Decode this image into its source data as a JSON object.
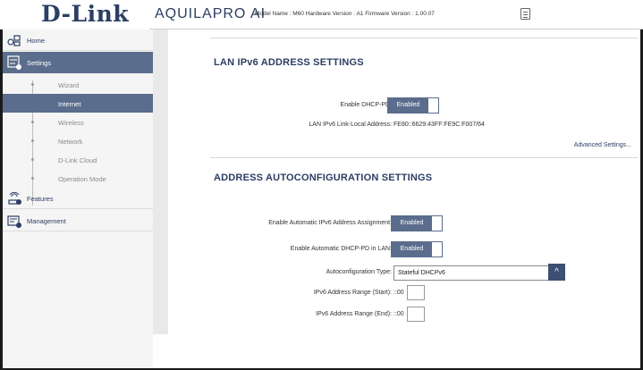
{
  "header": {
    "logo": "D-Link",
    "brand": "AQUILAPRO AI",
    "model_info": "Model Name : M60 Hardware Version : A1 Firmware Version : 1.00.07"
  },
  "sidebar": {
    "home": "Home",
    "settings": "Settings",
    "settings_items": [
      "Wizard",
      "Internet",
      "Wireless",
      "Network",
      "D-Link Cloud",
      "Operation Mode"
    ],
    "features": "Features",
    "management": "Management"
  },
  "lan_section": {
    "title": "LAN IPv6 ADDRESS SETTINGS",
    "dhcp_pd_label": "Enable DHCP-PD:",
    "dhcp_pd_value": "Enabled",
    "link_local_label": "LAN IPv6 Link-Local Address:",
    "link_local_value": "FE80::6629:43FF:FE9C:F007/64",
    "advanced": "Advanced Settings..."
  },
  "auto_section": {
    "title": "ADDRESS AUTOCONFIGURATION SETTINGS",
    "auto_assign_label": "Enable Automatic IPv6 Address Assignment:",
    "auto_assign_value": "Enabled",
    "auto_dhcp_pd_label": "Enable Automatic DHCP-PD in LAN:",
    "auto_dhcp_pd_value": "Enabled",
    "type_label": "Autoconfiguration Type:",
    "type_value": "Stateful DHCPv6",
    "range_start_label": "IPv6 Address Range (Start):",
    "range_start_prefix": "::00",
    "range_end_label": "IPv6 Address Range (End):",
    "range_end_prefix": "::00"
  },
  "colors": {
    "accent": "#5b6d8c",
    "brand": "#2b3e63"
  },
  "icons": {
    "doc": "document-icon",
    "home": "home-icon",
    "settings": "settings-icon",
    "features": "features-icon",
    "management": "management-icon",
    "collapse": "chevron-up-icon"
  }
}
